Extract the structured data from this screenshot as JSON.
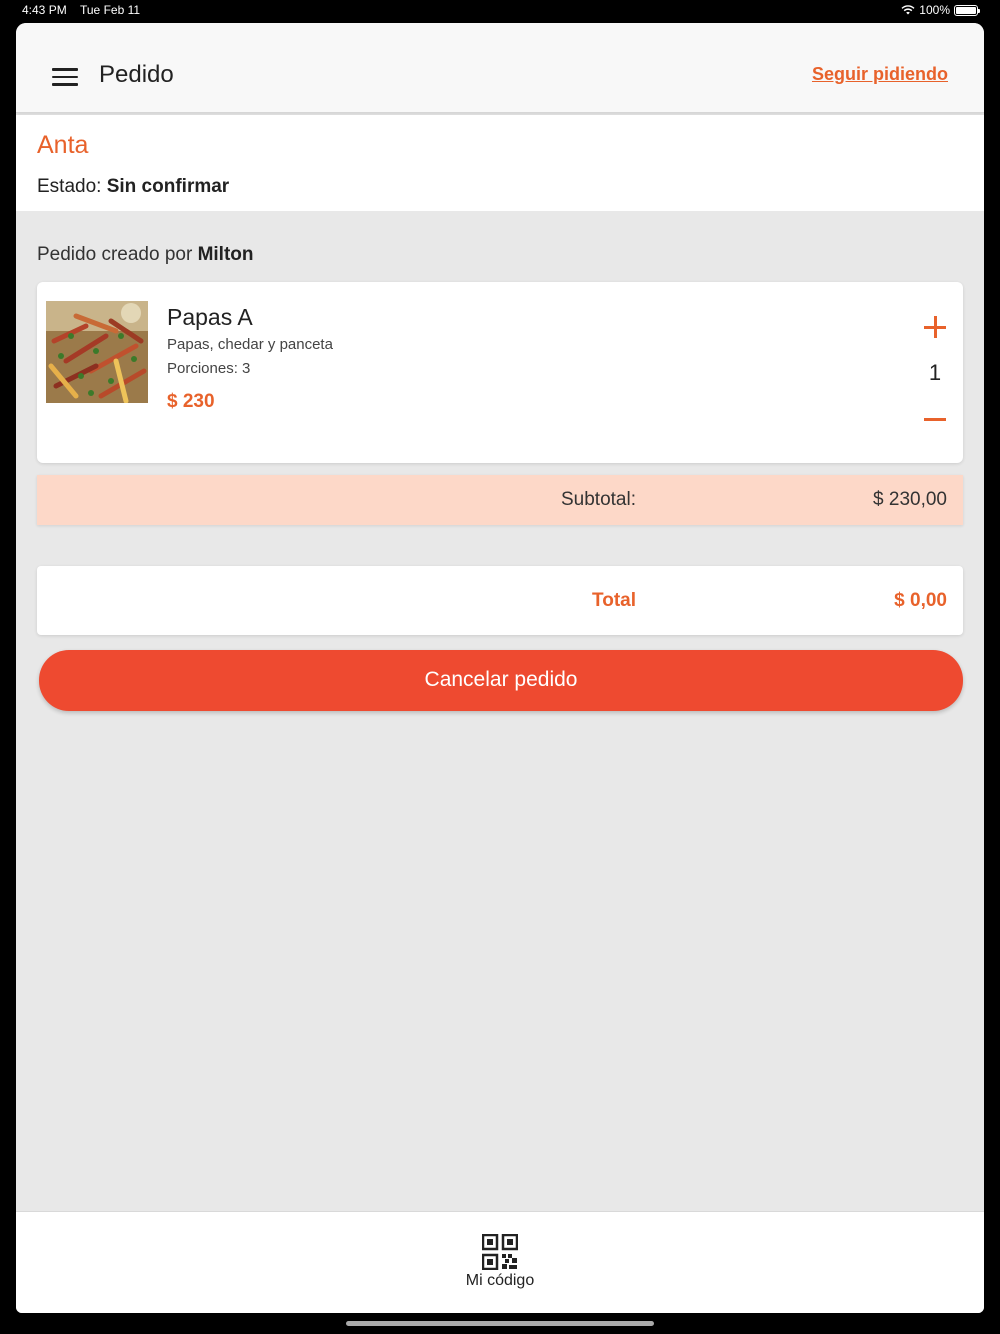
{
  "status_bar": {
    "time": "4:43 PM",
    "date": "Tue Feb 11",
    "battery": "100%"
  },
  "header": {
    "title": "Pedido",
    "continue_link": "Seguir pidiendo"
  },
  "store": {
    "name": "Anta",
    "status_label": "Estado:",
    "status_value": "Sin confirmar"
  },
  "order": {
    "created_by_label": "Pedido creado por",
    "created_by_name": "Milton",
    "items": [
      {
        "name": "Papas A",
        "description": "Papas, chedar y panceta",
        "portions": "Porciones: 3",
        "price": "$ 230",
        "quantity": "1"
      }
    ],
    "subtotal_label": "Subtotal:",
    "subtotal_value": "$ 230,00",
    "total_label": "Total",
    "total_value": "$ 0,00",
    "cancel_label": "Cancelar pedido"
  },
  "bottom_nav": {
    "qr_label": "Mi código",
    "qr_icon": "qr-code-icon"
  },
  "colors": {
    "accent": "#e8622b",
    "cancel": "#ee4a30",
    "subtotal_bg": "#fdd8c8",
    "page_bg": "#e8e8e8"
  }
}
